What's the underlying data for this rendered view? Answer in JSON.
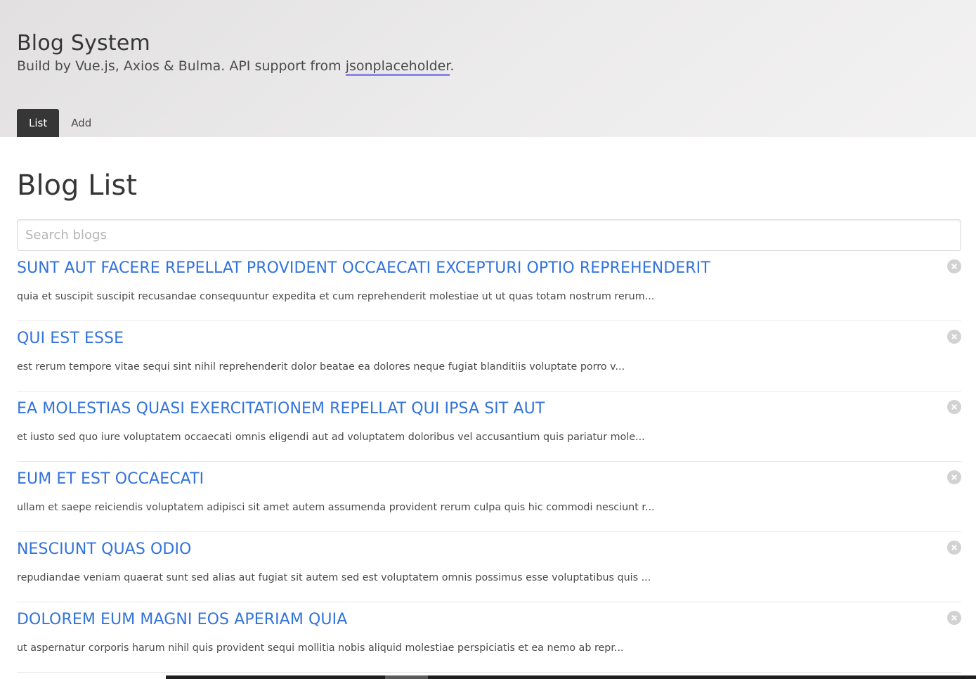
{
  "hero": {
    "title": "Blog System",
    "subtitle_prefix": "Build by Vue.js, Axios & Bulma. API support from ",
    "api_link": "jsonplaceholder",
    "subtitle_suffix": "."
  },
  "tabs": [
    {
      "label": "List",
      "active": true
    },
    {
      "label": "Add",
      "active": false
    }
  ],
  "main": {
    "title": "Blog List",
    "search_placeholder": "Search blogs",
    "search_value": ""
  },
  "posts": [
    {
      "title": "SUNT AUT FACERE REPELLAT PROVIDENT OCCAECATI EXCEPTURI OPTIO REPREHENDERIT",
      "excerpt": "quia et suscipit suscipit recusandae consequuntur expedita et cum reprehenderit molestiae ut ut quas totam nostrum rerum..."
    },
    {
      "title": "QUI EST ESSE",
      "excerpt": "est rerum tempore vitae sequi sint nihil reprehenderit dolor beatae ea dolores neque fugiat blanditiis voluptate porro v..."
    },
    {
      "title": "EA MOLESTIAS QUASI EXERCITATIONEM REPELLAT QUI IPSA SIT AUT",
      "excerpt": "et iusto sed quo iure voluptatem occaecati omnis eligendi aut ad voluptatem doloribus vel accusantium quis pariatur mole..."
    },
    {
      "title": "EUM ET EST OCCAECATI",
      "excerpt": "ullam et saepe reiciendis voluptatem adipisci sit amet autem assumenda provident rerum culpa quis hic commodi nesciunt r..."
    },
    {
      "title": "NESCIUNT QUAS ODIO",
      "excerpt": "repudiandae veniam quaerat sunt sed alias aut fugiat sit autem sed est voluptatem omnis possimus esse voluptatibus quis ..."
    },
    {
      "title": "DOLOREM EUM MAGNI EOS APERIAM QUIA",
      "excerpt": "ut aspernatur corporis harum nihil quis provident sequi mollitia nobis aliquid molestiae perspiciatis et ea nemo ab repr..."
    }
  ],
  "colors": {
    "link": "#3273dc",
    "active_tab_bg": "#363636",
    "link_underline": "#8d86e3",
    "delete_icon": "#d2d2d2"
  }
}
